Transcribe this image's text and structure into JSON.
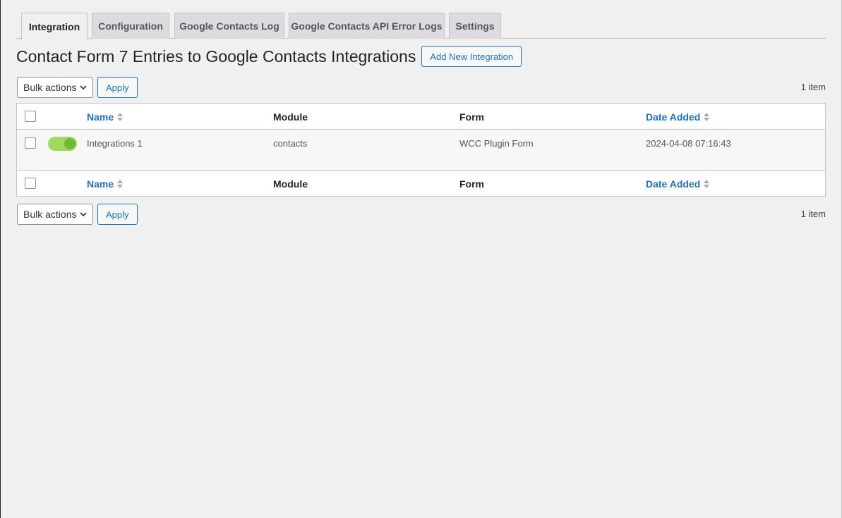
{
  "tabs": [
    {
      "label": "Integration",
      "active": true
    },
    {
      "label": "Configuration",
      "active": false
    },
    {
      "label": "Google Contacts Log",
      "active": false
    },
    {
      "label": "Google Contacts API Error Logs",
      "active": false
    },
    {
      "label": "Settings",
      "active": false
    }
  ],
  "page": {
    "title": "Contact Form 7 Entries to Google Contacts Integrations",
    "add_new_label": "Add New Integration"
  },
  "tablenav": {
    "bulk_actions": "Bulk actions",
    "apply_label": "Apply",
    "items_count": "1 item"
  },
  "table": {
    "columns": {
      "name": "Name",
      "module": "Module",
      "form": "Form",
      "date_added": "Date Added"
    },
    "rows": [
      {
        "enabled": true,
        "name": "Integrations 1",
        "module": "contacts",
        "form": "WCC Plugin Form",
        "date_added": "2024-04-08 07:16:43"
      }
    ]
  },
  "colors": {
    "accent": "#2271b1",
    "toggle_on": "#a0d860",
    "background": "#f0f0f1"
  }
}
